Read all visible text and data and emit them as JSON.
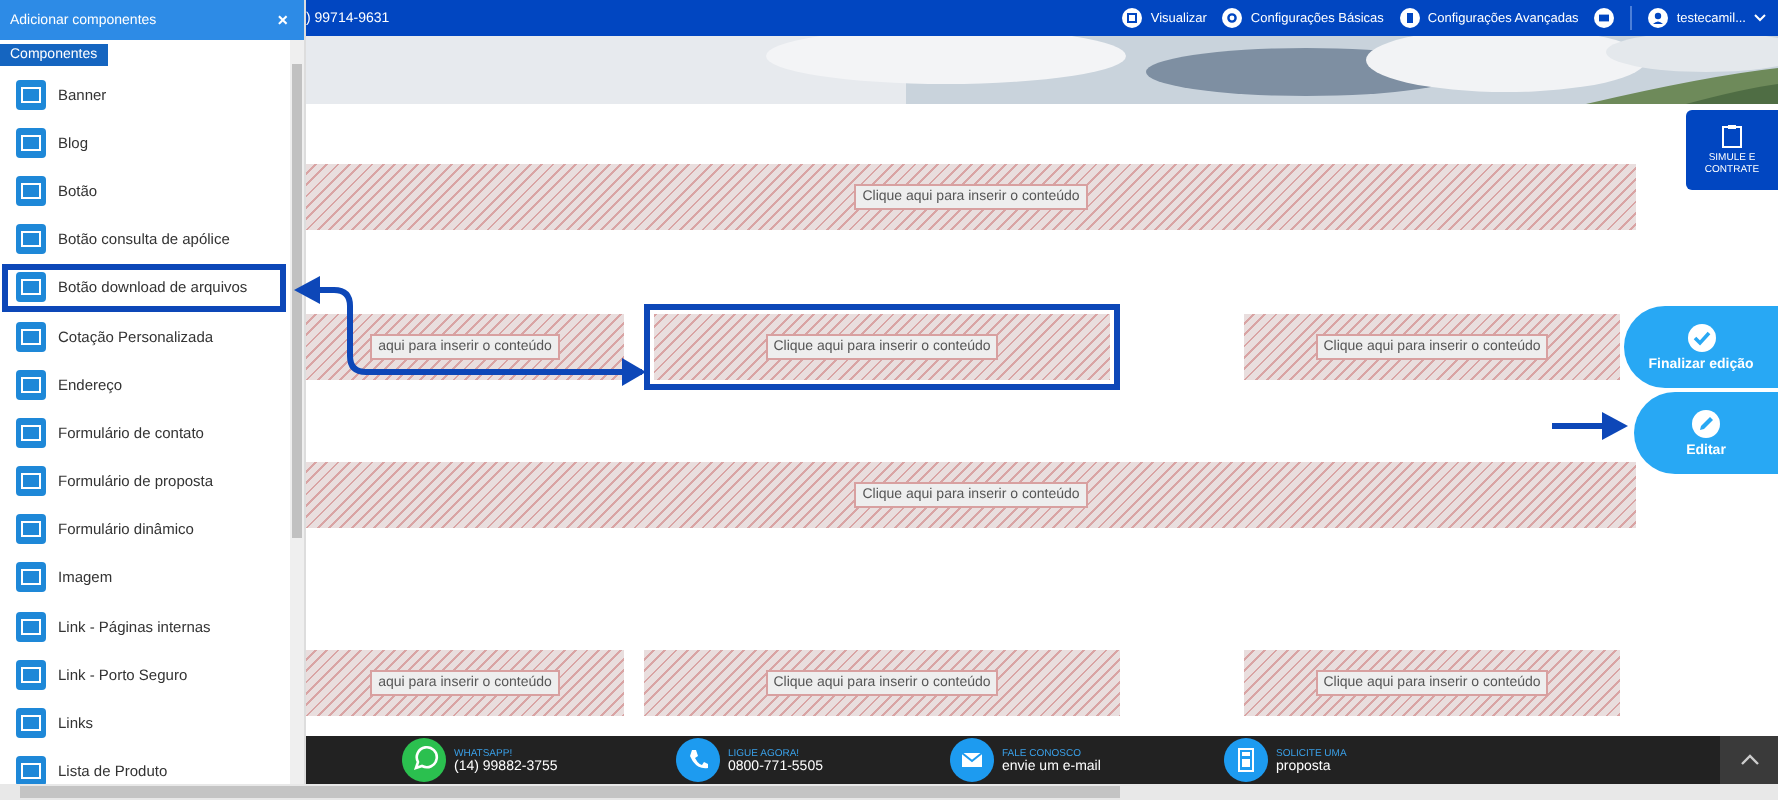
{
  "sidebar": {
    "title": "Adicionar componentes",
    "close": "×",
    "tab": "Componentes",
    "items": [
      {
        "label": "Banner",
        "selected": false
      },
      {
        "label": "Blog",
        "selected": false
      },
      {
        "label": "Botão",
        "selected": false
      },
      {
        "label": "Botão consulta de apólice",
        "selected": false
      },
      {
        "label": "Botão download de arquivos",
        "selected": true
      },
      {
        "label": "Cotação Personalizada",
        "selected": false
      },
      {
        "label": "Endereço",
        "selected": false
      },
      {
        "label": "Formulário de contato",
        "selected": false
      },
      {
        "label": "Formulário de proposta",
        "selected": false
      },
      {
        "label": "Formulário dinâmico",
        "selected": false
      },
      {
        "label": "Imagem",
        "selected": false
      },
      {
        "label": "Link - Páginas internas",
        "selected": false
      },
      {
        "label": "Link - Porto Seguro",
        "selected": false
      },
      {
        "label": "Links",
        "selected": false
      },
      {
        "label": "Lista de Produto",
        "selected": false
      }
    ]
  },
  "topbar": {
    "phone": ") 99714-9631",
    "links": [
      {
        "label": "Visualizar",
        "kind": "preview"
      },
      {
        "label": "Configurações Básicas",
        "kind": "gear"
      },
      {
        "label": "Configurações Avançadas",
        "kind": "file"
      }
    ],
    "user": "testecamil..."
  },
  "rows": [
    {
      "blocks": [
        {
          "label": "Clique aqui para inserir o conteúdo",
          "selected": false
        }
      ]
    },
    {
      "blocks": [
        {
          "label": "aqui para inserir o conteúdo",
          "selected": false
        },
        {
          "label": "Clique aqui para inserir o conteúdo",
          "selected": true
        },
        {
          "label": "Clique aqui para inserir o conteúdo",
          "selected": false
        }
      ]
    },
    {
      "blocks": [
        {
          "label": "Clique aqui para inserir o conteúdo",
          "selected": false
        }
      ]
    },
    {
      "blocks": [
        {
          "label": "aqui para inserir o conteúdo",
          "selected": false
        },
        {
          "label": "Clique aqui para inserir o conteúdo",
          "selected": false
        },
        {
          "label": "Clique aqui para inserir o conteúdo",
          "selected": false
        }
      ]
    }
  ],
  "simulate": "SIMULE E CONTRATE",
  "actions": [
    {
      "label": "Finalizar edição",
      "kind": "check"
    },
    {
      "label": "Editar",
      "kind": "pencil"
    }
  ],
  "footer": [
    {
      "title": "WHATSAPP!",
      "value": "(14) 99882-3755",
      "kind": "whatsapp"
    },
    {
      "title": "LIGUE AGORA!",
      "value": "0800-771-5505",
      "kind": "phone"
    },
    {
      "title": "FALE CONOSCO",
      "value": "envie um e-mail",
      "kind": "mail"
    },
    {
      "title": "SOLICITE UMA",
      "value": "proposta",
      "kind": "calculator"
    }
  ]
}
